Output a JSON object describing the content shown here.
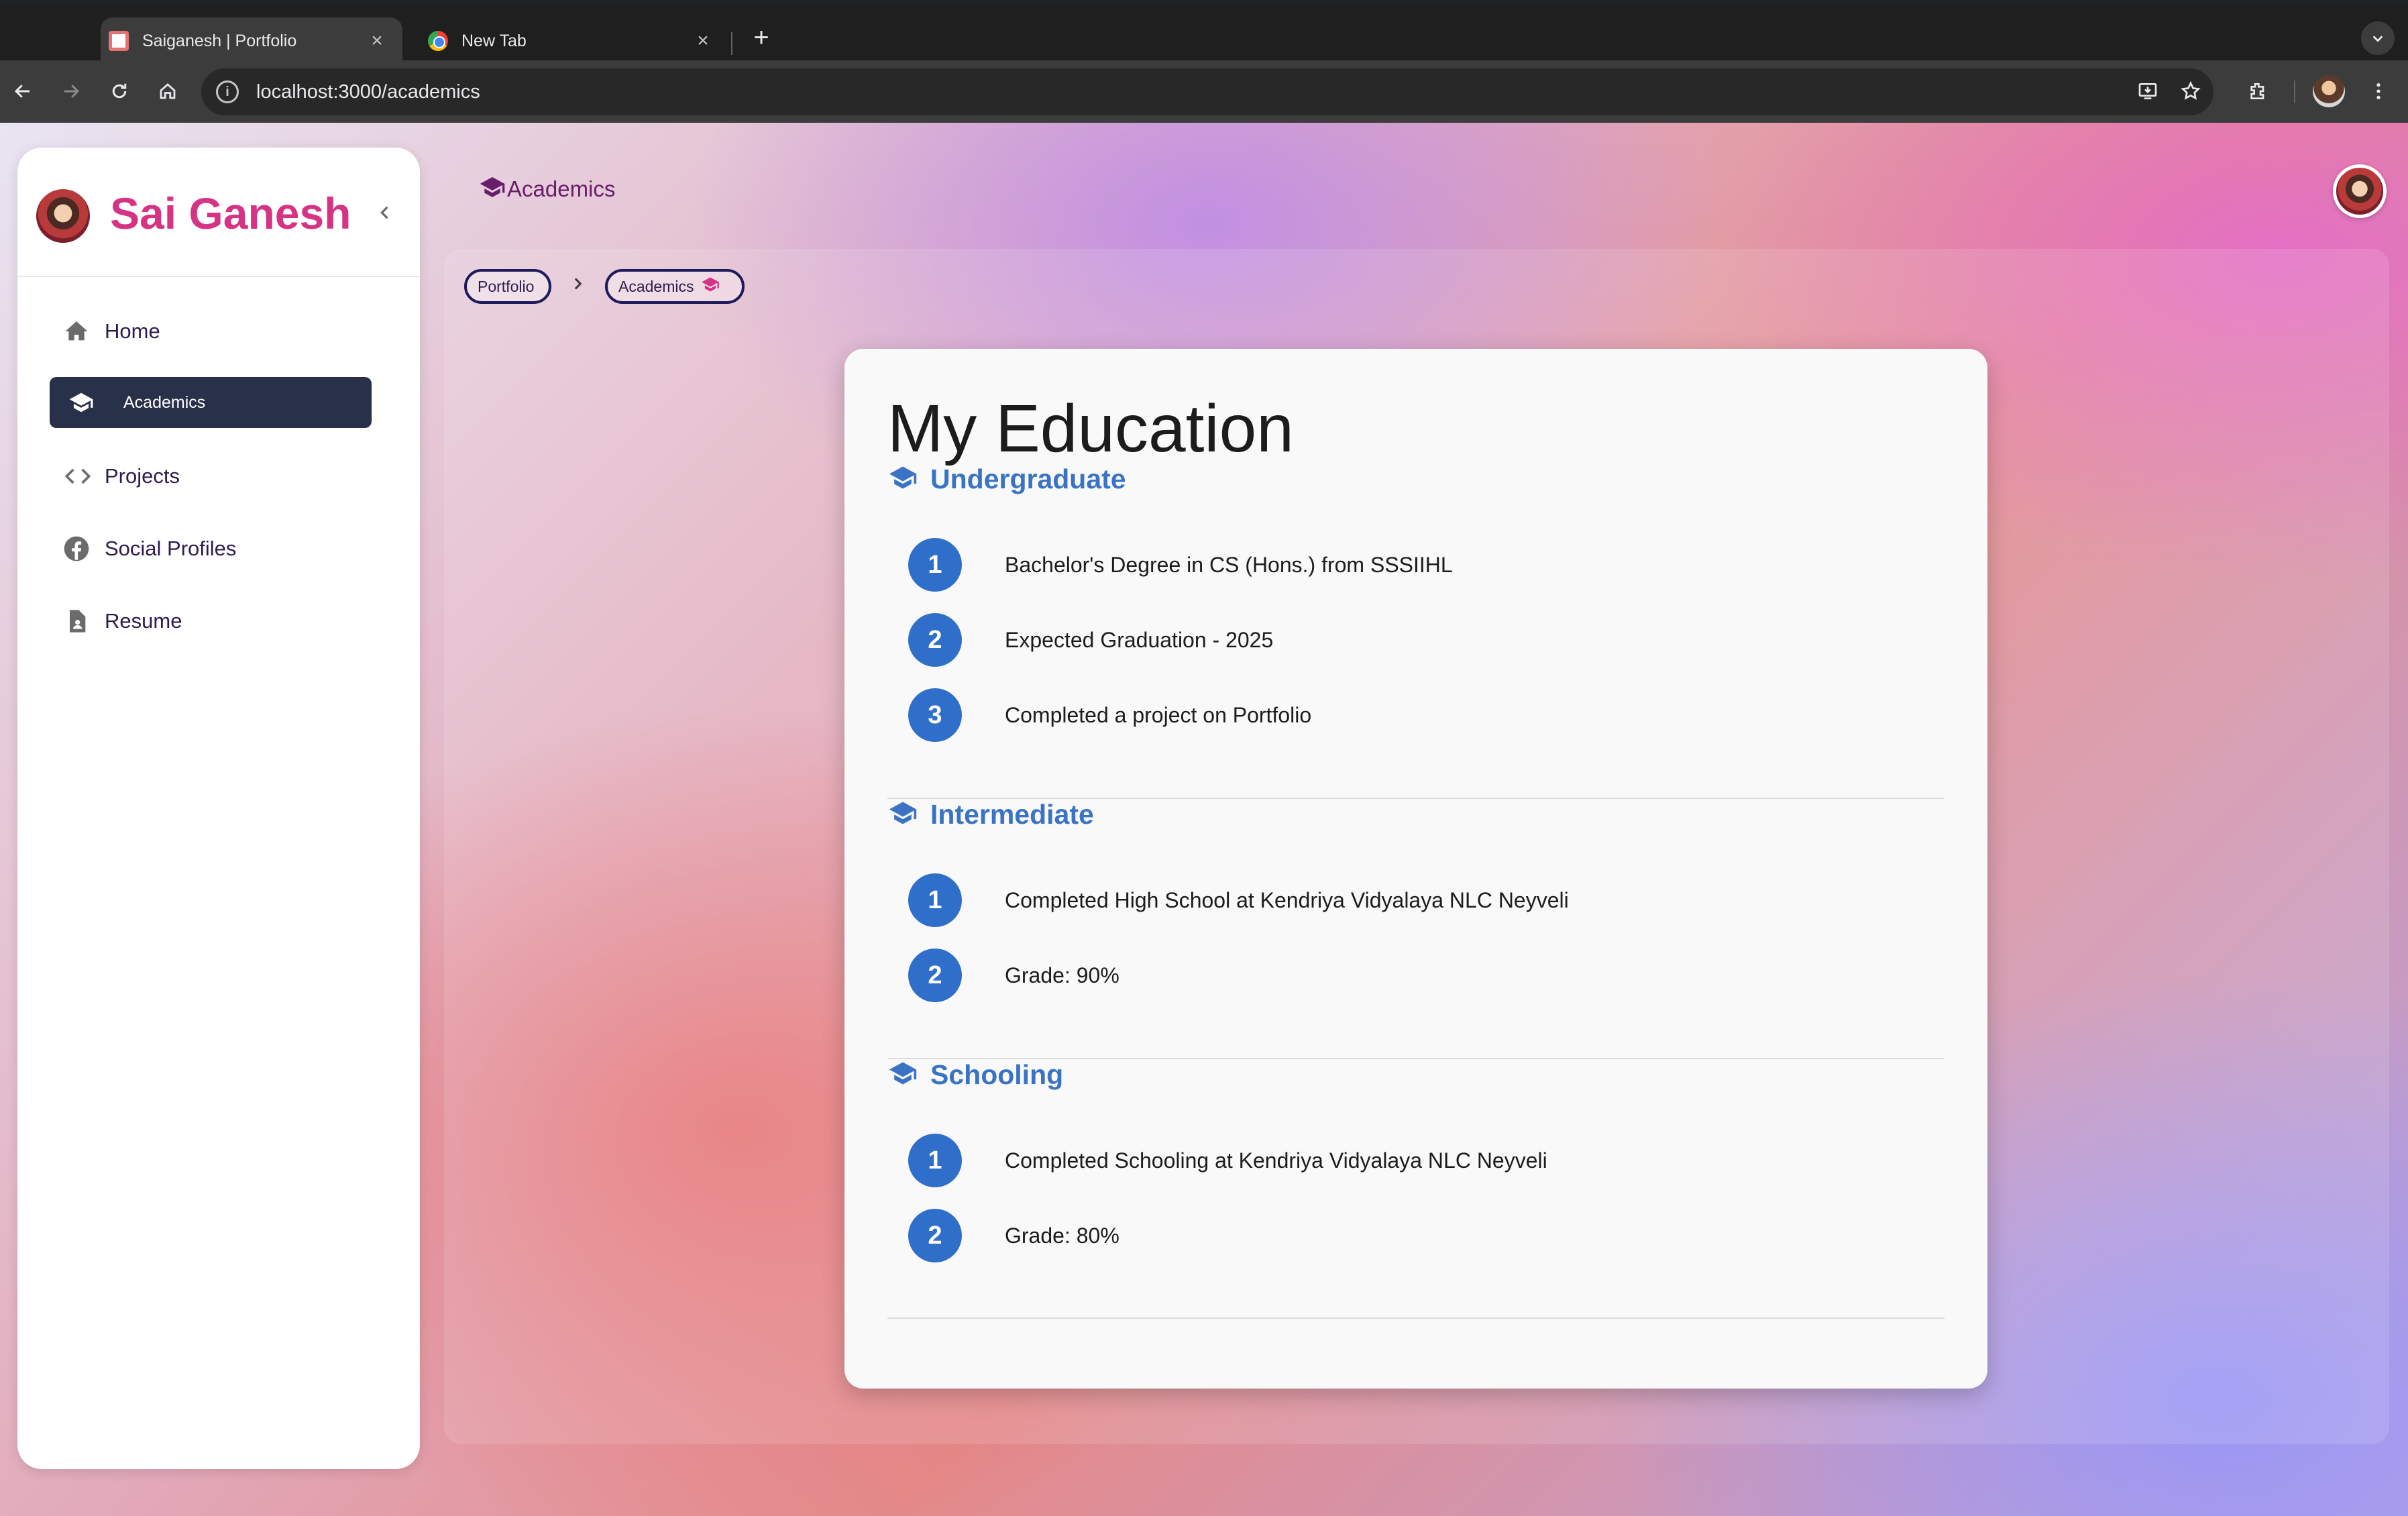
{
  "browser": {
    "tabs": [
      {
        "title": "Saiganesh | Portfolio",
        "active": true
      },
      {
        "title": "New Tab",
        "active": false
      }
    ],
    "close_glyph": "×",
    "new_tab_glyph": "+",
    "url": "localhost:3000/academics"
  },
  "sidebar": {
    "name": "Sai Ganesh",
    "items": [
      {
        "label": "Home",
        "icon": "home-icon"
      },
      {
        "label": "Academics",
        "icon": "graduation-cap-icon",
        "active": true
      },
      {
        "label": "Projects",
        "icon": "code-icon"
      },
      {
        "label": "Social Profiles",
        "icon": "facebook-icon"
      },
      {
        "label": "Resume",
        "icon": "document-icon"
      }
    ]
  },
  "header": {
    "title": "Academics"
  },
  "breadcrumb": {
    "items": [
      "Portfolio",
      "Academics"
    ]
  },
  "education": {
    "title": "My Education",
    "sections": [
      {
        "heading": "Undergraduate",
        "items": [
          {
            "num": "1",
            "text": "Bachelor's Degree in CS (Hons.) from SSSIIHL"
          },
          {
            "num": "2",
            "text": "Expected Graduation - 2025"
          },
          {
            "num": "3",
            "text": "Completed a project on Portfolio"
          }
        ]
      },
      {
        "heading": "Intermediate",
        "items": [
          {
            "num": "1",
            "text": "Completed High School at Kendriya Vidyalaya NLC Neyveli"
          },
          {
            "num": "2",
            "text": "Grade: 90%"
          }
        ]
      },
      {
        "heading": "Schooling",
        "items": [
          {
            "num": "1",
            "text": "Completed Schooling at Kendriya Vidyalaya NLC Neyveli"
          },
          {
            "num": "2",
            "text": "Grade: 80%"
          }
        ]
      }
    ]
  },
  "colors": {
    "accent_name": "#d63384",
    "section_heading": "#3b73c4",
    "number_badge": "#2f6fca",
    "active_nav": "#29304a"
  }
}
